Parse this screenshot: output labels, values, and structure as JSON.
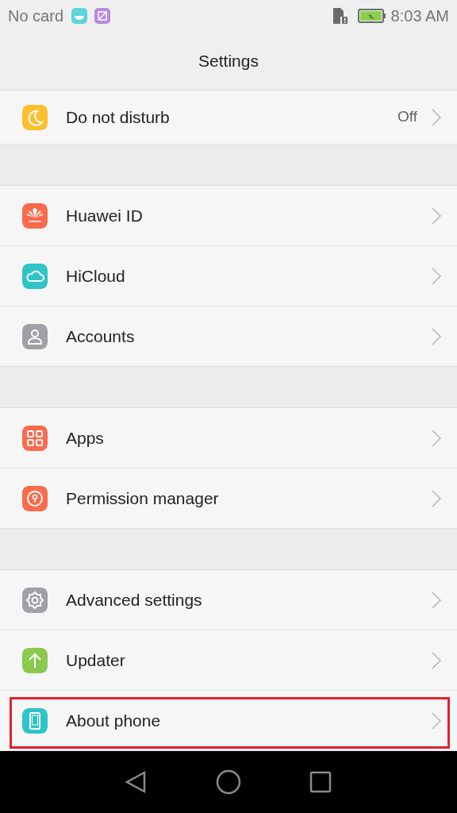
{
  "status_bar": {
    "carrier": "No card",
    "time": "8:03 AM"
  },
  "title": "Settings",
  "groups": [
    {
      "items": [
        {
          "label": "Do not disturb",
          "value": "Off",
          "kind": "moon",
          "color": "#fbc02d",
          "highlighted": false
        }
      ]
    },
    {
      "items": [
        {
          "label": "Huawei ID",
          "kind": "flower",
          "color": "#fa6a4c",
          "highlighted": false
        },
        {
          "label": "HiCloud",
          "kind": "cloud",
          "color": "#2ec4c8",
          "highlighted": false
        },
        {
          "label": "Accounts",
          "kind": "person",
          "color": "#a0a0a6",
          "highlighted": false
        }
      ]
    },
    {
      "items": [
        {
          "label": "Apps",
          "kind": "grid",
          "color": "#fa6a4c",
          "highlighted": false
        },
        {
          "label": "Permission manager",
          "kind": "lock",
          "color": "#fa6a4c",
          "highlighted": false
        }
      ]
    },
    {
      "items": [
        {
          "label": "Advanced settings",
          "kind": "gear",
          "color": "#a0a0a6",
          "highlighted": false
        },
        {
          "label": "Updater",
          "kind": "arrow",
          "color": "#8bc94f",
          "highlighted": false
        },
        {
          "label": "About phone",
          "kind": "phone",
          "color": "#2ec4c8",
          "highlighted": true
        }
      ]
    }
  ]
}
